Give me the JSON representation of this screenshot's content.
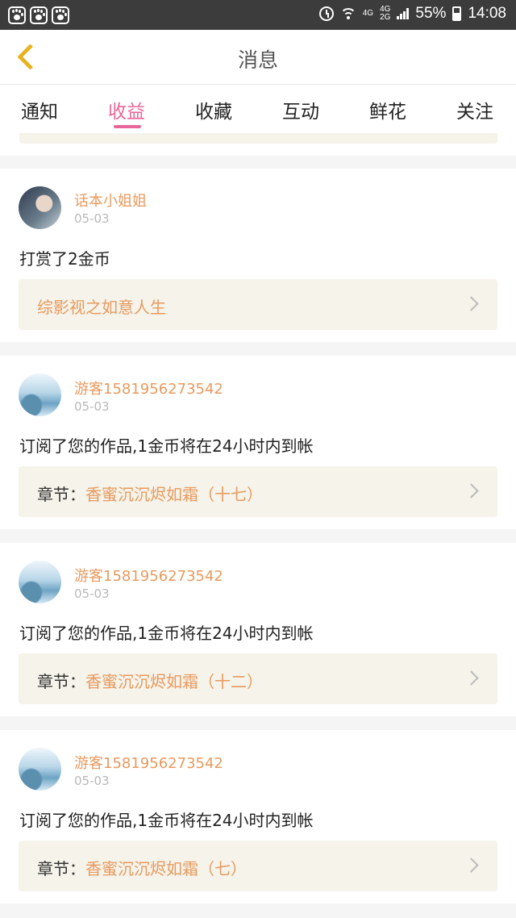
{
  "status_bar": {
    "network_a": "4G",
    "network_b_top": "4G",
    "network_b_bottom": "2G",
    "battery": "55%",
    "time": "14:08"
  },
  "header": {
    "title": "消息"
  },
  "tabs": [
    {
      "label": "通知"
    },
    {
      "label": "收益"
    },
    {
      "label": "收藏"
    },
    {
      "label": "互动"
    },
    {
      "label": "鲜花"
    },
    {
      "label": "关注"
    }
  ],
  "active_tab": "收益",
  "messages": [
    {
      "user": "话本小姐姐",
      "date": "05-03",
      "text": "打赏了2金币",
      "link_prefix": "",
      "link_title": "综影视之如意人生"
    },
    {
      "user": "游客1581956273542",
      "date": "05-03",
      "text": "订阅了您的作品,1金币将在24小时内到帐",
      "link_prefix": "章节：",
      "link_title": "香蜜沉沉烬如霜（十七）"
    },
    {
      "user": "游客1581956273542",
      "date": "05-03",
      "text": "订阅了您的作品,1金币将在24小时内到帐",
      "link_prefix": "章节：",
      "link_title": "香蜜沉沉烬如霜（十二）"
    },
    {
      "user": "游客1581956273542",
      "date": "05-03",
      "text": "订阅了您的作品,1金币将在24小时内到帐",
      "link_prefix": "章节：",
      "link_title": "香蜜沉沉烬如霜（七）"
    }
  ]
}
